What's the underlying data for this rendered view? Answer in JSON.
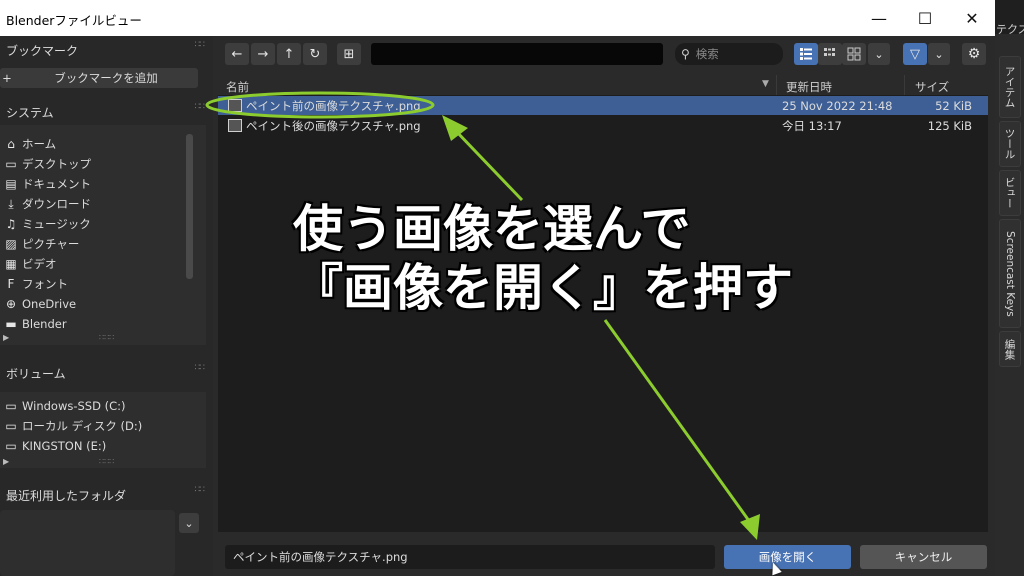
{
  "window": {
    "title": "Blenderファイルビュー",
    "minimize_glyph": "—",
    "maximize_glyph": "☐",
    "close_glyph": "✕"
  },
  "right_panel": {
    "top_label": "テクス",
    "tabs": [
      "アイテム",
      "ツール",
      "ビュー",
      "Screencast Keys",
      "編集"
    ]
  },
  "sidebar": {
    "bookmarks": {
      "header": "ブックマーク",
      "add_button": "ブックマークを追加",
      "add_icon": "+"
    },
    "system": {
      "header": "システム",
      "items": [
        {
          "icon": "home-icon",
          "glyph": "⌂",
          "label": "ホーム"
        },
        {
          "icon": "desktop-icon",
          "glyph": "▭",
          "label": "デスクトップ"
        },
        {
          "icon": "documents-icon",
          "glyph": "▤",
          "label": "ドキュメント"
        },
        {
          "icon": "download-icon",
          "glyph": "⤓",
          "label": "ダウンロード"
        },
        {
          "icon": "music-icon",
          "glyph": "♫",
          "label": "ミュージック"
        },
        {
          "icon": "pictures-icon",
          "glyph": "▨",
          "label": "ピクチャー"
        },
        {
          "icon": "video-icon",
          "glyph": "▦",
          "label": "ビデオ"
        },
        {
          "icon": "font-icon",
          "glyph": "F",
          "label": "フォント"
        },
        {
          "icon": "globe-icon",
          "glyph": "⊕",
          "label": "OneDrive"
        },
        {
          "icon": "folder-icon",
          "glyph": "▬",
          "label": "Blender"
        }
      ]
    },
    "volumes": {
      "header": "ボリューム",
      "items": [
        {
          "icon": "drive-icon",
          "glyph": "▭",
          "label": "Windows-SSD (C:)"
        },
        {
          "icon": "drive-icon",
          "glyph": "▭",
          "label": "ローカル ディスク (D:)"
        },
        {
          "icon": "drive-icon",
          "glyph": "▭",
          "label": "KINGSTON (E:)"
        }
      ]
    },
    "recent": {
      "header": "最近利用したフォルダ"
    }
  },
  "toolbar": {
    "back": "←",
    "forward": "→",
    "parent": "↑",
    "refresh": "↻",
    "new_folder": "⊞",
    "path_value": "",
    "search_placeholder": "検索",
    "filter_icon": "▽",
    "gear_icon": "⚙",
    "chevron": "⌄"
  },
  "file_list": {
    "columns": {
      "name": "名前",
      "date": "更新日時",
      "size": "サイズ",
      "sort_indicator": "▼"
    },
    "rows": [
      {
        "name": "ペイント前の画像テクスチャ.png",
        "date": "25 Nov 2022 21:48",
        "size": "52 KiB",
        "selected": true
      },
      {
        "name": "ペイント後の画像テクスチャ.png",
        "date": "今日 13:17",
        "size": "125 KiB",
        "selected": false
      }
    ]
  },
  "bottom": {
    "filename_value": "ペイント前の画像テクスチャ.png",
    "open_button": "画像を開く",
    "cancel_button": "キャンセル"
  },
  "annotation": {
    "line1": "使う画像を選んで",
    "line2": "『画像を開く』を押す",
    "color": "#8ccc2e"
  },
  "colors": {
    "selection": "#3d5f95",
    "open_button": "#4772b3",
    "active_toggle": "#4772b3"
  }
}
